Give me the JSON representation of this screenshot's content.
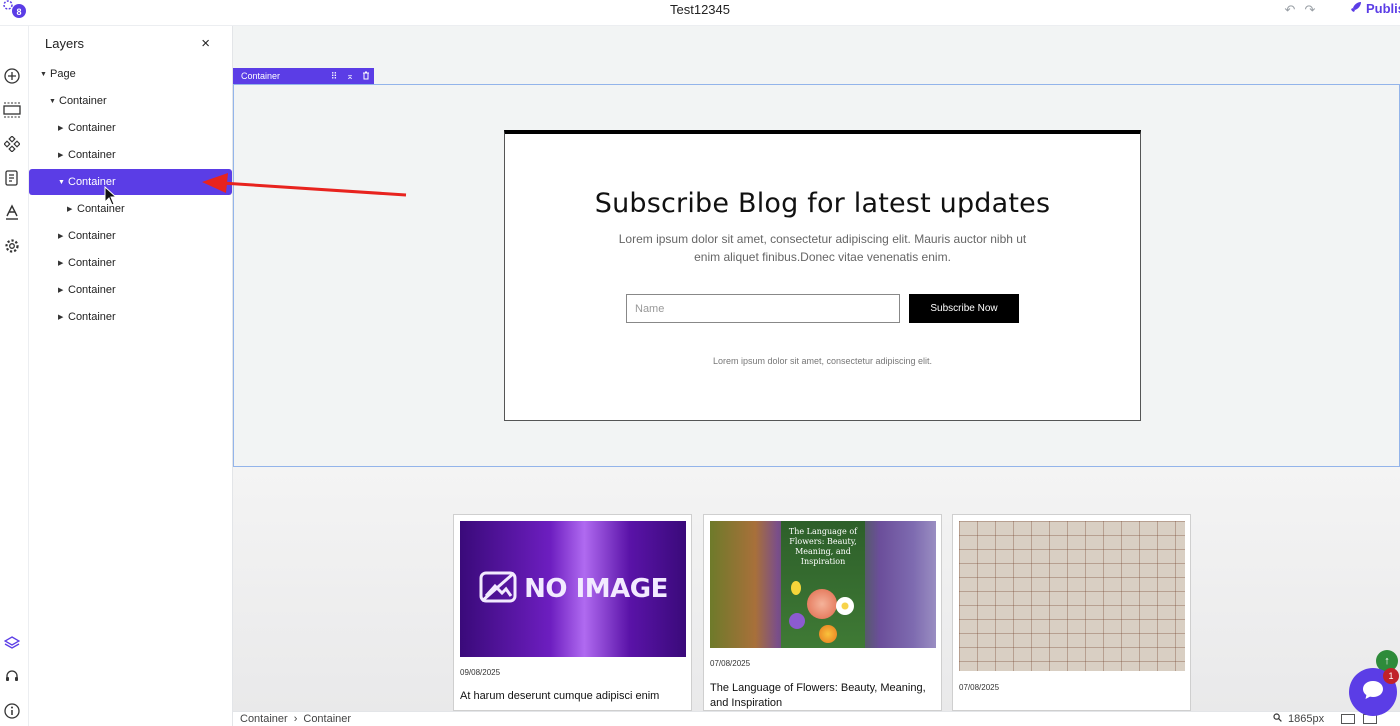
{
  "app": {
    "title": "Test12345",
    "publish_label": "Publis",
    "accent_color": "#5b3de6"
  },
  "rail": {
    "icons": [
      "plus-circle-icon",
      "section-icon",
      "components-icon",
      "pages-icon",
      "text-style-icon",
      "settings-icon",
      "layers-icon",
      "support-icon",
      "info-icon"
    ]
  },
  "layers": {
    "heading": "Layers",
    "close_symbol": "×",
    "items": [
      {
        "label": "Page",
        "depth": 0,
        "expanded": true
      },
      {
        "label": "Container",
        "depth": 1,
        "expanded": true
      },
      {
        "label": "Container",
        "depth": 2,
        "expanded": false
      },
      {
        "label": "Container",
        "depth": 2,
        "expanded": false
      },
      {
        "label": "Container",
        "depth": 2,
        "expanded": true,
        "selected": true
      },
      {
        "label": "Container",
        "depth": 3,
        "expanded": false
      },
      {
        "label": "Container",
        "depth": 2,
        "expanded": false
      },
      {
        "label": "Container",
        "depth": 2,
        "expanded": false
      },
      {
        "label": "Container",
        "depth": 2,
        "expanded": false
      },
      {
        "label": "Container",
        "depth": 2,
        "expanded": false
      }
    ]
  },
  "canvas": {
    "selected_tag": "Container",
    "subscribe": {
      "title": "Subscribe Blog for latest updates",
      "text": "Lorem ipsum dolor sit amet, consectetur adipiscing elit. Mauris auctor nibh ut enim aliquet finibus.Donec vitae venenatis enim.",
      "input_placeholder": "Name",
      "button_label": "Subscribe Now",
      "footnote": "Lorem ipsum dolor sit amet, consectetur adipiscing elit."
    },
    "cards": [
      {
        "image_text": "NO IMAGE",
        "date": "09/08/2025",
        "title": "At harum deserunt cumque adipisci enim"
      },
      {
        "image_text": "The Language of Flowers: Beauty, Meaning, and Inspiration",
        "date": "07/08/2025",
        "title": "The Language of Flowers: Beauty, Meaning, and Inspiration"
      },
      {
        "date": "07/08/2025",
        "title": ""
      }
    ]
  },
  "bottombar": {
    "breadcrumb": [
      "Container",
      "Container"
    ],
    "zoom": "1865px"
  },
  "chat": {
    "badge": "1"
  }
}
